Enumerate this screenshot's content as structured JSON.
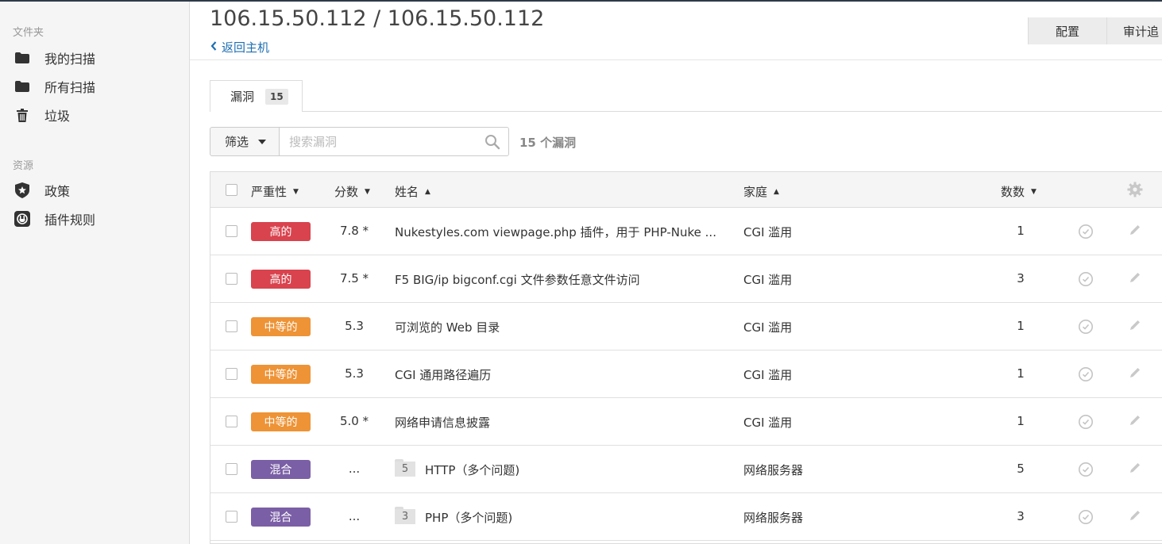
{
  "sidebar": {
    "section_folders": "文件夹",
    "items_folders": [
      {
        "label": "我的扫描",
        "icon": "folder-icon"
      },
      {
        "label": "所有扫描",
        "icon": "folder-icon"
      },
      {
        "label": "垃圾",
        "icon": "trash-icon"
      }
    ],
    "section_resources": "资源",
    "items_resources": [
      {
        "label": "政策",
        "icon": "policy-shield-icon"
      },
      {
        "label": "插件规则",
        "icon": "plugin-rules-icon"
      }
    ]
  },
  "header": {
    "title": "106.15.50.112 / 106.15.50.112",
    "back_label": "返回主机",
    "configure_label": "配置",
    "audit_label": "审计追"
  },
  "tabs": [
    {
      "label": "漏洞",
      "count": "15"
    }
  ],
  "toolbar": {
    "filter_label": "筛选",
    "search_placeholder": "搜索漏洞",
    "result_count": "15 个漏洞"
  },
  "table": {
    "headers": {
      "severity": "严重性",
      "score": "分数",
      "name": "姓名",
      "family": "家庭",
      "count": "数数"
    },
    "rows": [
      {
        "severity": "高的",
        "sev_color": "#d9434e",
        "score": "7.8 *",
        "name": "Nukestyles.com viewpage.php 插件，用于 PHP-Nuke ...",
        "family": "CGI 滥用",
        "count": "1"
      },
      {
        "severity": "高的",
        "sev_color": "#d9434e",
        "score": "7.5 *",
        "name": "F5 BIG/ip bigconf.cgi 文件参数任意文件访问",
        "family": "CGI 滥用",
        "count": "3"
      },
      {
        "severity": "中等的",
        "sev_color": "#ee9336",
        "score": "5.3",
        "name": "可浏览的 Web 目录",
        "family": "CGI 滥用",
        "count": "1"
      },
      {
        "severity": "中等的",
        "sev_color": "#ee9336",
        "score": "5.3",
        "name": "CGI 通用路径遍历",
        "family": "CGI 滥用",
        "count": "1"
      },
      {
        "severity": "中等的",
        "sev_color": "#ee9336",
        "score": "5.0 *",
        "name": "网络申请信息披露",
        "family": "CGI 滥用",
        "count": "1"
      },
      {
        "severity": "混合",
        "sev_color": "#7b5fa6",
        "score": "...",
        "group_count": "5",
        "name": "HTTP（多个问题)",
        "family": "网络服务器",
        "count": "5"
      },
      {
        "severity": "混合",
        "sev_color": "#7b5fa6",
        "score": "...",
        "group_count": "3",
        "name": "PHP（多个问题)",
        "family": "网络服务器",
        "count": "3"
      }
    ]
  }
}
